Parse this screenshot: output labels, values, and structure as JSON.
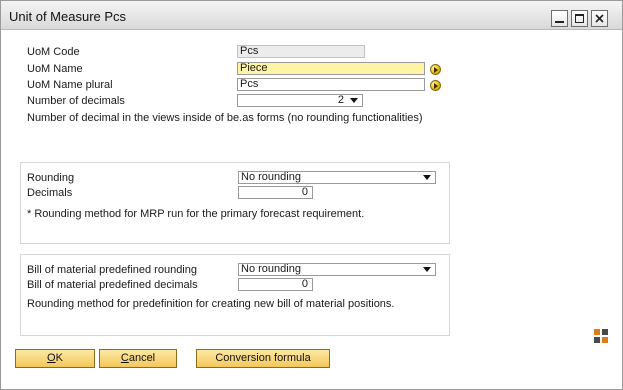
{
  "window": {
    "title": "Unit of Measure Pcs"
  },
  "fields": {
    "uom_code": {
      "label": "UoM Code",
      "value": "Pcs"
    },
    "uom_name": {
      "label": "UoM Name",
      "value": "Piece"
    },
    "uom_name_plural": {
      "label": "UoM Name plural",
      "value": "Pcs"
    },
    "number_of_decimals": {
      "label": "Number of decimals",
      "value": "2"
    }
  },
  "decimals_note": "Number of decimal in the views inside of be.as forms (no rounding functionalities)",
  "rounding_group": {
    "rounding_label": "Rounding",
    "rounding_value": "No rounding",
    "decimals_label": "Decimals",
    "decimals_value": "0",
    "note": "* Rounding method for MRP run for the primary forecast requirement."
  },
  "bom_group": {
    "rounding_label": "Bill of material predefined rounding",
    "rounding_value": "No rounding",
    "decimals_label": "Bill of material predefined decimals",
    "decimals_value": "0",
    "note": "Rounding method for predefinition for creating new bill of material positions."
  },
  "buttons": {
    "ok_mnemonic": "O",
    "ok_rest": "K",
    "cancel_mnemonic": "C",
    "cancel_rest": "ancel",
    "conversion": "Conversion formula"
  },
  "colors": {
    "active_field": "#fff3a6",
    "button_gradient_top": "#fde9a4",
    "button_gradient_bottom": "#f4c75a"
  }
}
